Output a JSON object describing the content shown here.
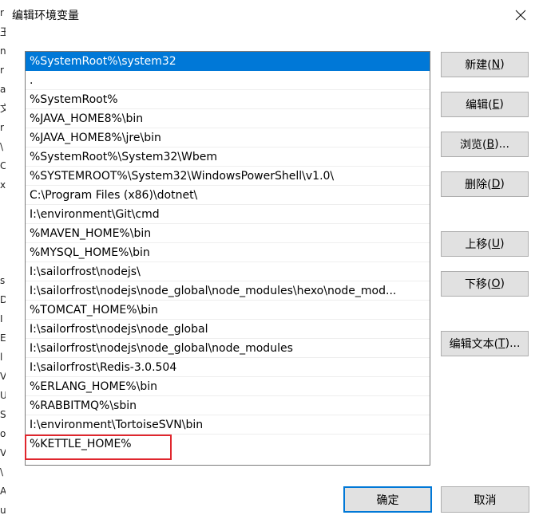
{
  "dialog": {
    "title": "编辑环境变量",
    "close_glyph": "✕"
  },
  "background_window": {
    "fragments": [
      "r",
      "玉",
      "n",
      "r",
      "a",
      "文",
      "r",
      "\\",
      "C",
      "x",
      "s",
      "D",
      "I",
      "E",
      "l",
      "V",
      "U",
      "S",
      "o",
      "V",
      "\\",
      "A",
      "u"
    ]
  },
  "path_list": {
    "items": [
      "%SystemRoot%\\system32",
      ".",
      "%SystemRoot%",
      "%JAVA_HOME8%\\bin",
      "%JAVA_HOME8%\\jre\\bin",
      "%SystemRoot%\\System32\\Wbem",
      "%SYSTEMROOT%\\System32\\WindowsPowerShell\\v1.0\\",
      "C:\\Program Files (x86)\\dotnet\\",
      "I:\\environment\\Git\\cmd",
      "%MAVEN_HOME%\\bin",
      "%MYSQL_HOME%\\bin",
      "I:\\sailorfrost\\nodejs\\",
      "I:\\sailorfrost\\nodejs\\node_global\\node_modules\\hexo\\node_mod...",
      "%TOMCAT_HOME%\\bin",
      "I:\\sailorfrost\\nodejs\\node_global",
      "I:\\sailorfrost\\nodejs\\node_global\\node_modules",
      "I:\\sailorfrost\\Redis-3.0.504",
      "%ERLANG_HOME%\\bin",
      "%RABBITMQ%\\sbin",
      "I:\\environment\\TortoiseSVN\\bin",
      "%KETTLE_HOME%"
    ],
    "selected_index": 0,
    "editing_index": 20
  },
  "buttons": {
    "new": {
      "label": "新建(",
      "key": "N",
      "tail": ")"
    },
    "edit": {
      "label": "编辑(",
      "key": "E",
      "tail": ")"
    },
    "browse": {
      "label": "浏览(",
      "key": "B",
      "tail": ")..."
    },
    "delete": {
      "label": "删除(",
      "key": "D",
      "tail": ")"
    },
    "move_up": {
      "label": "上移(",
      "key": "U",
      "tail": ")"
    },
    "move_down": {
      "label": "下移(",
      "key": "O",
      "tail": ")"
    },
    "edit_text": {
      "label": "编辑文本(",
      "key": "T",
      "tail": ")..."
    }
  },
  "footer": {
    "ok_label": "确定",
    "cancel_label": "取消"
  },
  "colors": {
    "selection": "#0078d7",
    "highlight_border": "#e0262d",
    "button_face": "#e1e1e1"
  }
}
